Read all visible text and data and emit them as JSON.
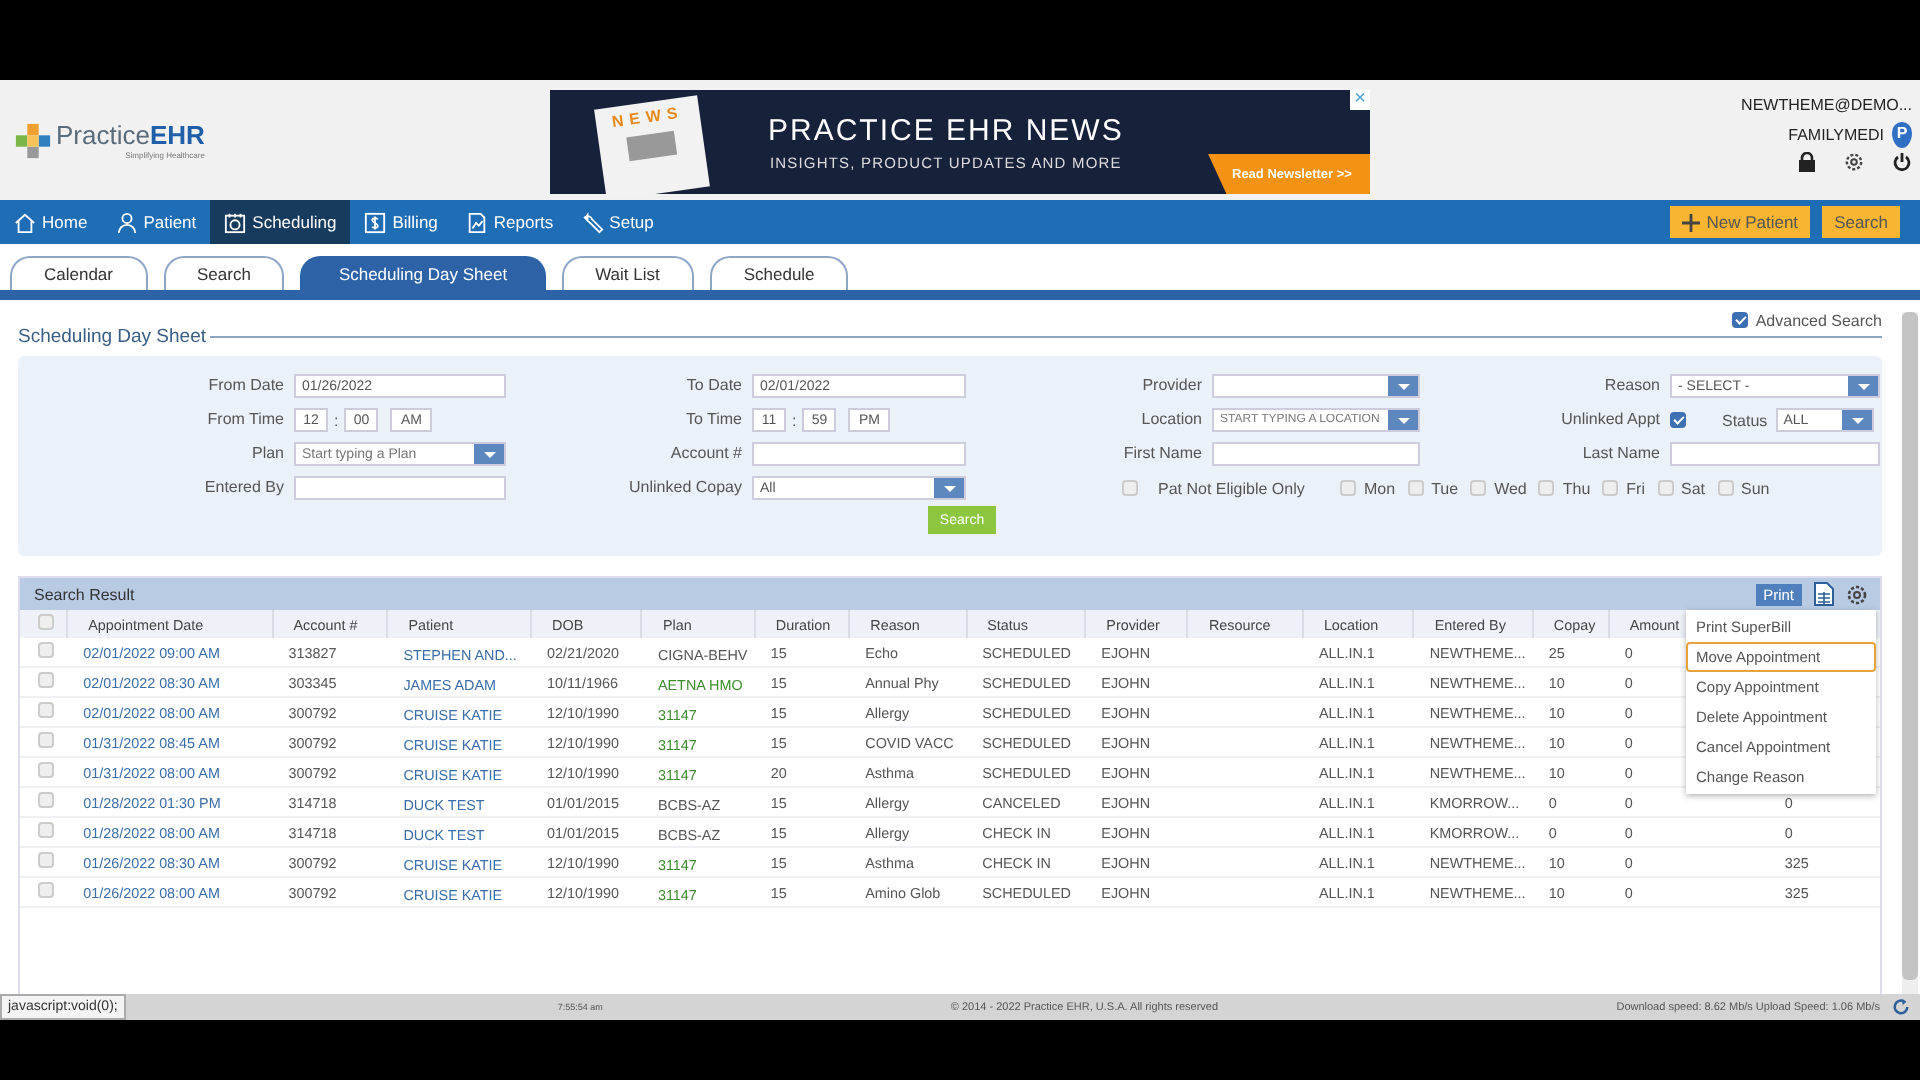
{
  "header": {
    "logo": "Practice**EHR**",
    "tagline": "Simplifying Healthcare",
    "banner": {
      "badge": "NEWS",
      "title": "PRACTICE EHR NEWS",
      "subtitle": "INSIGHTS, PRODUCT UPDATES AND MORE",
      "cta": "Read Newsletter >>",
      "close": "×"
    },
    "user": "NEWTHEME@DEMO...",
    "practice": "FAMILYMEDI",
    "pin": "P"
  },
  "nav": [
    {
      "label": "Home",
      "selected": false
    },
    {
      "label": "Patient",
      "selected": false
    },
    {
      "label": "Scheduling",
      "selected": true
    },
    {
      "label": "Billing",
      "selected": false
    },
    {
      "label": "Reports",
      "selected": false
    },
    {
      "label": "Setup",
      "selected": false
    }
  ],
  "nav_buttons": {
    "new_patient": "New Patient",
    "search": "Search"
  },
  "tabs": [
    {
      "label": "Calendar",
      "selected": false
    },
    {
      "label": "Search",
      "selected": false
    },
    {
      "label": "Scheduling Day Sheet",
      "selected": true
    },
    {
      "label": "Wait List",
      "selected": false
    },
    {
      "label": "Schedule",
      "selected": false
    }
  ],
  "advanced_search": {
    "label": "Advanced Search",
    "checked": true
  },
  "section_title": "Scheduling Day Sheet",
  "filters": {
    "from_date": {
      "label": "From Date",
      "value": "01/26/2022"
    },
    "to_date": {
      "label": "To Date",
      "value": "02/01/2022"
    },
    "provider": {
      "label": "Provider"
    },
    "reason": {
      "label": "Reason",
      "value": "- SELECT -"
    },
    "from_time": {
      "label": "From Time",
      "hour": "12",
      "sep": ":",
      "minute": "00",
      "ampm": "AM"
    },
    "to_time": {
      "label": "To Time",
      "hour": "11",
      "sep": ":",
      "minute": "59",
      "ampm": "PM"
    },
    "location": {
      "label": "Location",
      "placeholder": "START TYPING A LOCATION"
    },
    "unlinked_appt": {
      "label": "Unlinked Appt",
      "checked": true
    },
    "status": {
      "label": "Status",
      "value": "ALL"
    },
    "plan": {
      "label": "Plan",
      "placeholder": "Start typing a Plan"
    },
    "account": {
      "label": "Account #"
    },
    "first_name": {
      "label": "First Name"
    },
    "last_name": {
      "label": "Last Name"
    },
    "entered_by": {
      "label": "Entered By"
    },
    "unlinked_copay": {
      "label": "Unlinked Copay",
      "value": "All"
    },
    "pat_not_eligible": {
      "label": "Pat Not Eligible Only",
      "checked": false
    },
    "days": [
      {
        "label": "Mon",
        "checked": false
      },
      {
        "label": "Tue",
        "checked": false
      },
      {
        "label": "Wed",
        "checked": false
      },
      {
        "label": "Thu",
        "checked": false
      },
      {
        "label": "Fri",
        "checked": false
      },
      {
        "label": "Sat",
        "checked": false
      },
      {
        "label": "Sun",
        "checked": false
      }
    ],
    "search_button": "Search"
  },
  "results": {
    "title": "Search Result",
    "print": "Print",
    "select_all": {
      "checked": false
    },
    "columns": [
      "Appointment Date",
      "Account #",
      "Patient",
      "DOB",
      "Plan",
      "Duration",
      "Reason",
      "Status",
      "Provider",
      "Resource",
      "Location",
      "Entered By",
      "Copay",
      "Amount"
    ],
    "rows": [
      {
        "checked": false,
        "date": "02/01/2022 09:00 AM",
        "account": "313827",
        "patient": "STEPHEN AND...",
        "dob": "02/21/2020",
        "plan": {
          "text": "CIGNA-BEHV",
          "color": "#555555"
        },
        "duration": "15",
        "reason": "Echo",
        "status": "SCHEDULED",
        "provider": "EJOHN",
        "location": "ALL.IN.1",
        "entered_by": "NEWTHEME...",
        "copay": "25",
        "amount": "0"
      },
      {
        "checked": false,
        "date": "02/01/2022 08:30 AM",
        "account": "303345",
        "patient": "JAMES ADAM",
        "dob": "10/11/1966",
        "plan": {
          "text": "AETNA HMO",
          "color": "#3c8a2e"
        },
        "duration": "15",
        "reason": "Annual Phy",
        "status": "SCHEDULED",
        "provider": "EJOHN",
        "location": "ALL.IN.1",
        "entered_by": "NEWTHEME...",
        "copay": "10",
        "amount": "0"
      },
      {
        "checked": false,
        "date": "02/01/2022 08:00 AM",
        "account": "300792",
        "patient": "CRUISE KATIE",
        "dob": "12/10/1990",
        "plan": {
          "text": "31147",
          "color": "#3c8a2e"
        },
        "duration": "15",
        "reason": "Allergy",
        "status": "SCHEDULED",
        "provider": "EJOHN",
        "location": "ALL.IN.1",
        "entered_by": "NEWTHEME...",
        "copay": "10",
        "amount": "0"
      },
      {
        "checked": false,
        "date": "01/31/2022 08:45 AM",
        "account": "300792",
        "patient": "CRUISE KATIE",
        "dob": "12/10/1990",
        "plan": {
          "text": "31147",
          "color": "#3c8a2e"
        },
        "duration": "15",
        "reason": "COVID VACC",
        "status": "SCHEDULED",
        "provider": "EJOHN",
        "location": "ALL.IN.1",
        "entered_by": "NEWTHEME...",
        "copay": "10",
        "amount": "0"
      },
      {
        "checked": false,
        "date": "01/31/2022 08:00 AM",
        "account": "300792",
        "patient": "CRUISE KATIE",
        "dob": "12/10/1990",
        "plan": {
          "text": "31147",
          "color": "#3c8a2e"
        },
        "duration": "20",
        "reason": "Asthma",
        "status": "SCHEDULED",
        "provider": "EJOHN",
        "location": "ALL.IN.1",
        "entered_by": "NEWTHEME...",
        "copay": "10",
        "amount": "0"
      },
      {
        "checked": false,
        "date": "01/28/2022 01:30 PM",
        "account": "314718",
        "patient": "DUCK TEST",
        "dob": "01/01/2015",
        "plan": {
          "text": "BCBS-AZ",
          "color": "#555555"
        },
        "duration": "15",
        "reason": "Allergy",
        "status": "CANCELED",
        "provider": "EJOHN",
        "location": "ALL.IN.1",
        "entered_by": "KMORROW...",
        "copay": "0",
        "amount": "0",
        "column_15": "0"
      },
      {
        "checked": false,
        "date": "01/28/2022 08:00 AM",
        "account": "314718",
        "patient": "DUCK TEST",
        "dob": "01/01/2015",
        "plan": {
          "text": "BCBS-AZ",
          "color": "#555555"
        },
        "duration": "15",
        "reason": "Allergy",
        "status": "CHECK IN",
        "provider": "EJOHN",
        "location": "ALL.IN.1",
        "entered_by": "KMORROW...",
        "copay": "0",
        "amount": "0",
        "column_15": "0"
      },
      {
        "checked": false,
        "date": "01/26/2022 08:30 AM",
        "account": "300792",
        "patient": "CRUISE KATIE",
        "dob": "12/10/1990",
        "plan": {
          "text": "31147",
          "color": "#3c8a2e"
        },
        "duration": "15",
        "reason": "Asthma",
        "status": "CHECK IN",
        "provider": "EJOHN",
        "location": "ALL.IN.1",
        "entered_by": "NEWTHEME...",
        "copay": "10",
        "amount": "0",
        "column_15": "325"
      },
      {
        "checked": false,
        "date": "01/26/2022 08:00 AM",
        "account": "300792",
        "patient": "CRUISE KATIE",
        "dob": "12/10/1990",
        "plan": {
          "text": "31147",
          "color": "#3c8a2e"
        },
        "duration": "15",
        "reason": "Amino Glob",
        "status": "SCHEDULED",
        "provider": "EJOHN",
        "location": "ALL.IN.1",
        "entered_by": "NEWTHEME...",
        "copay": "10",
        "amount": "0",
        "column_15": "325"
      }
    ],
    "menu": [
      {
        "label": "Print SuperBill",
        "selected": false
      },
      {
        "label": "Move Appointment",
        "selected": true
      },
      {
        "label": "Copy Appointment",
        "selected": false
      },
      {
        "label": "Delete Appointment",
        "selected": false
      },
      {
        "label": "Cancel Appointment",
        "selected": false
      },
      {
        "label": "Change Reason",
        "selected": false
      }
    ]
  },
  "status_bar": {
    "link_hint": "javascript:void(0);",
    "time": "7:55:54 am",
    "copyright": "© 2014 - 2022 Practice EHR, U.S.A. All rights reserved",
    "speed": "Download speed: 8.62 Mb/s Upload Speed: 1.06 Mb/s"
  }
}
